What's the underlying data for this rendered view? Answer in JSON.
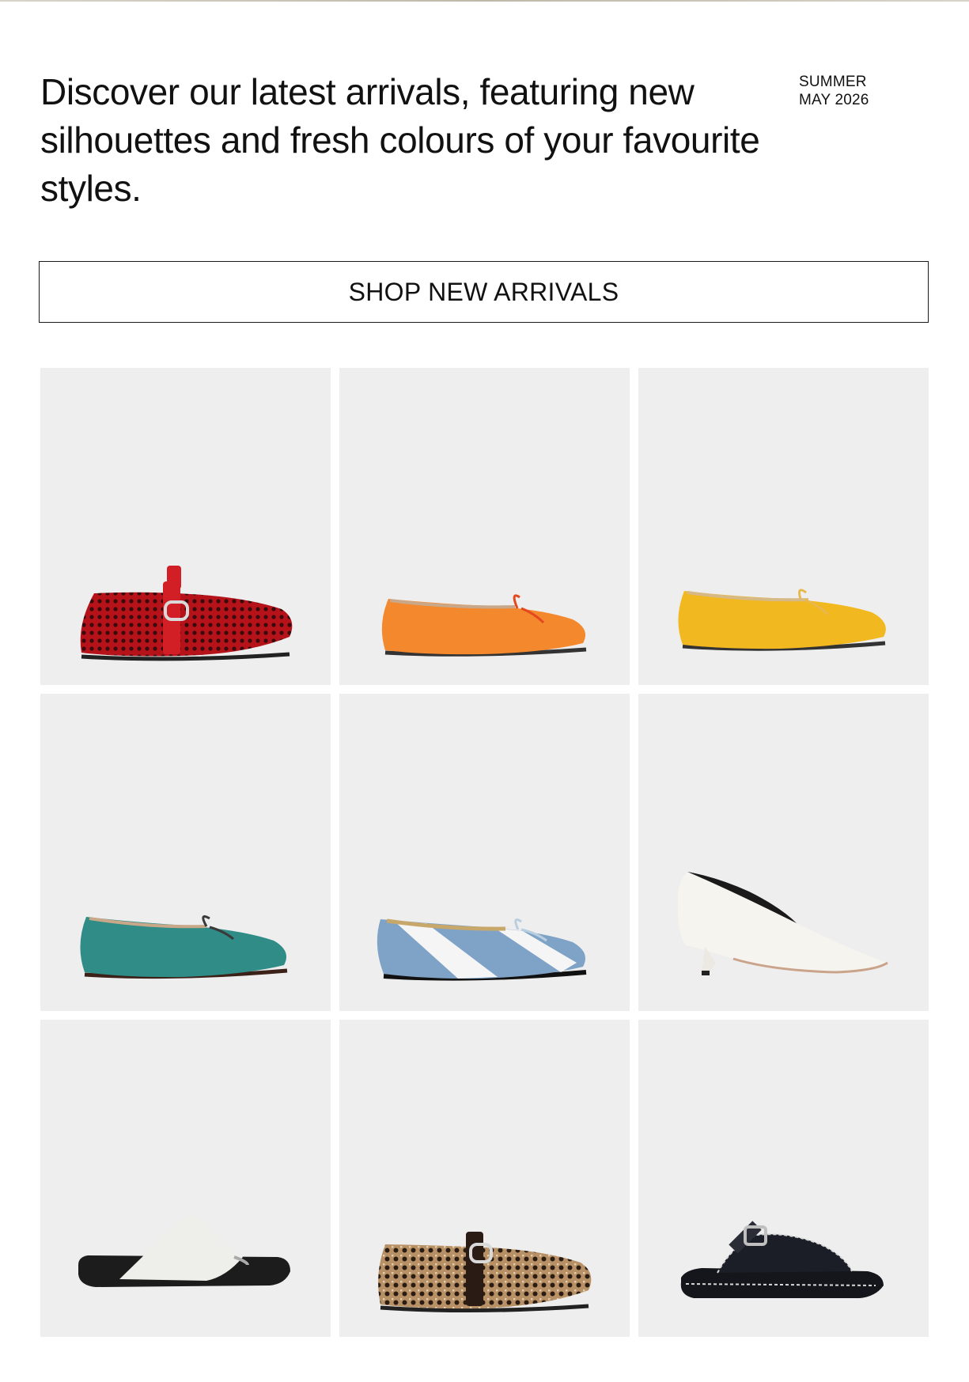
{
  "header": {
    "headline": "Discover our latest arrivals, featuring new silhouettes and fresh colours of your favourite styles.",
    "season": "SUMMER",
    "date": "MAY 2026"
  },
  "cta": {
    "label": "SHOP NEW ARRIVALS"
  },
  "products": [
    {
      "name": "red-woven-buckle-mary-jane-flat",
      "icon": "red-woven-flat-icon",
      "color": "#c8161b"
    },
    {
      "name": "orange-leather-bow-ballet-flat",
      "icon": "orange-ballet-flat-icon",
      "color": "#f4882c"
    },
    {
      "name": "yellow-leather-bow-ballet-flat",
      "icon": "yellow-ballet-flat-icon",
      "color": "#f2b81f"
    },
    {
      "name": "teal-leather-bow-ballet-flat",
      "icon": "teal-ballet-flat-icon",
      "color": "#2f8c86"
    },
    {
      "name": "blue-white-striped-ballet-flat",
      "icon": "striped-ballet-flat-icon",
      "color": "#8aa9c8"
    },
    {
      "name": "white-kitten-heel-pump",
      "icon": "white-kitten-heel-icon",
      "color": "#f3f1ec"
    },
    {
      "name": "white-black-toe-post-sandal",
      "icon": "toe-post-sandal-icon",
      "color": "#1c1c1c"
    },
    {
      "name": "leopard-woven-buckle-mary-jane-flat",
      "icon": "leopard-woven-flat-icon",
      "color": "#9c7a52"
    },
    {
      "name": "black-leather-buckle-slide-sandal",
      "icon": "black-buckle-sandal-icon",
      "color": "#14161c"
    }
  ]
}
